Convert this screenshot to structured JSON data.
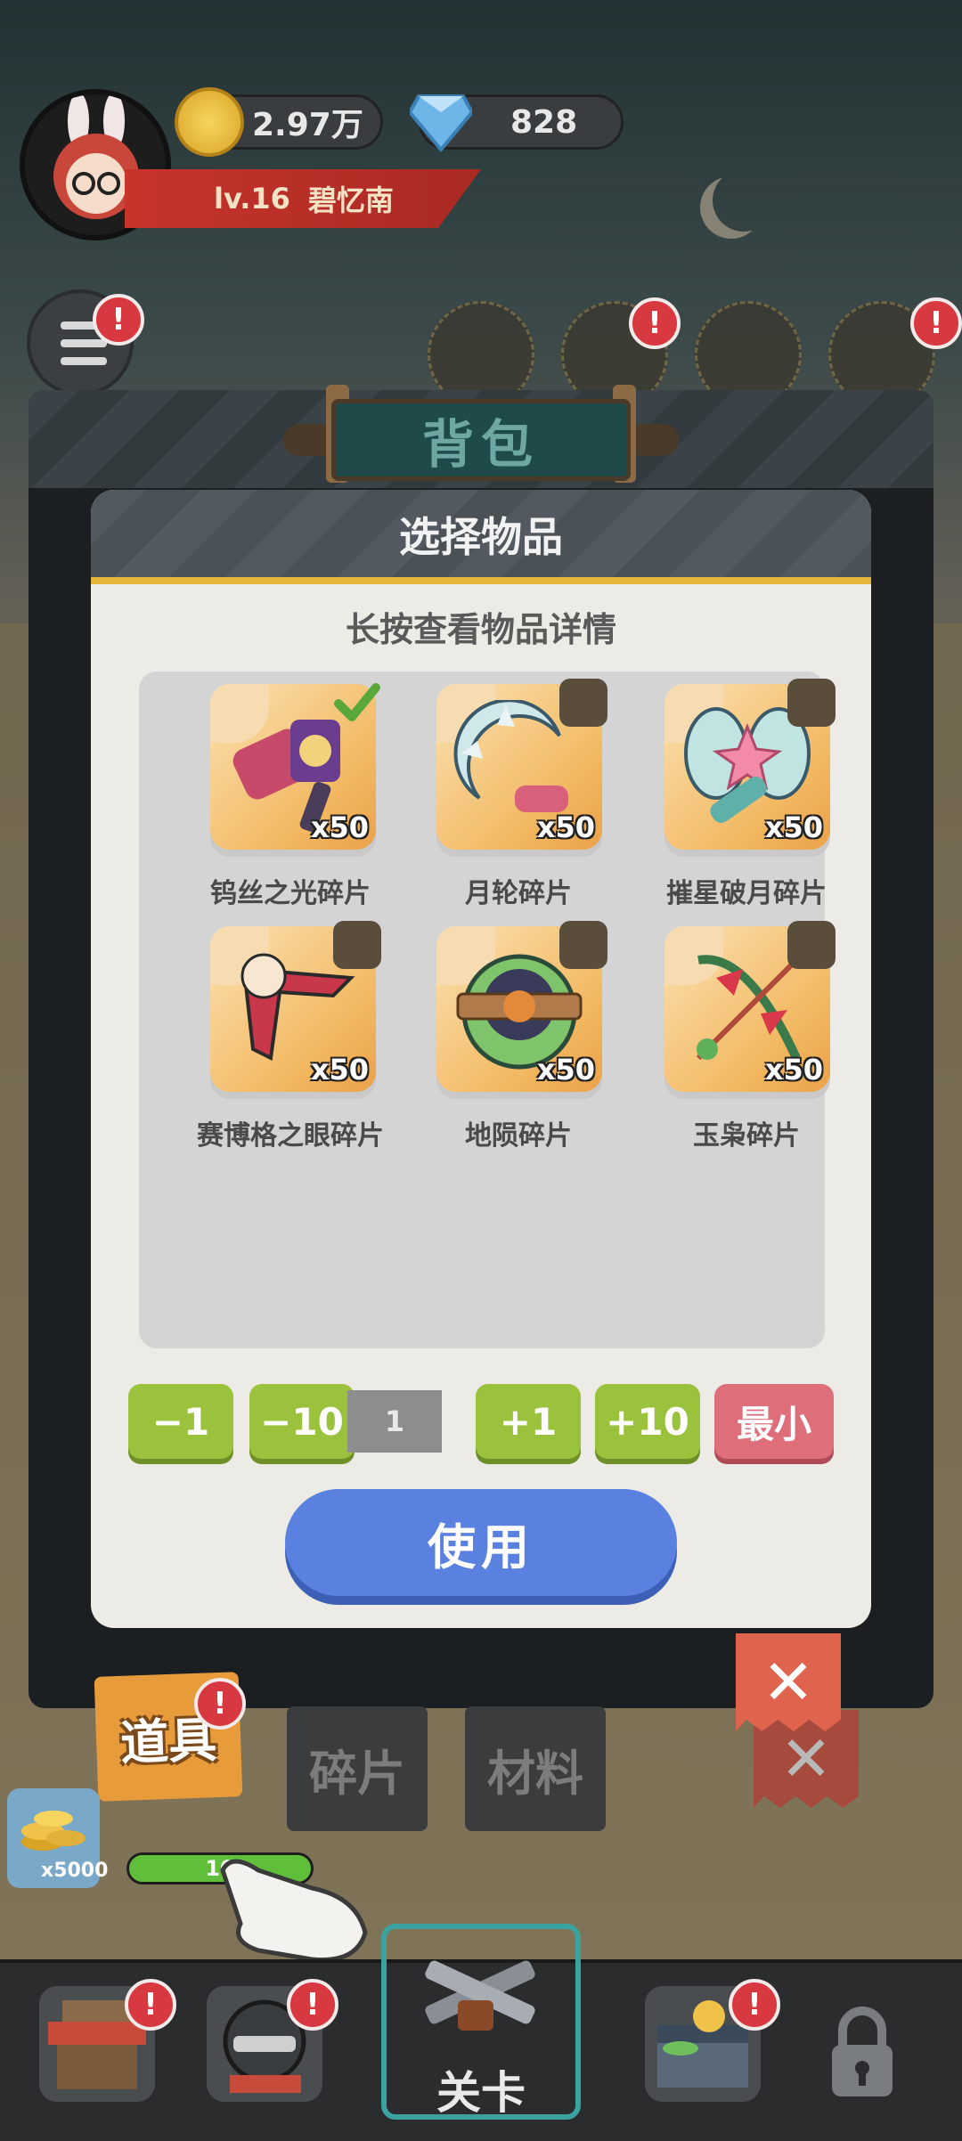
{
  "hud": {
    "coins": "2.97万",
    "gems": "828",
    "level": "lv.16",
    "player_name": "碧忆南"
  },
  "panel": {
    "title": "背包"
  },
  "dialog": {
    "title": "选择物品",
    "hint": "长按查看物品详情",
    "items": [
      {
        "name": "钨丝之光碎片",
        "qty": "x50",
        "selected": true,
        "icon": "hammer-lantern-icon"
      },
      {
        "name": "月轮碎片",
        "qty": "x50",
        "selected": false,
        "icon": "spiked-moon-icon"
      },
      {
        "name": "摧星破月碎片",
        "qty": "x50",
        "selected": false,
        "icon": "star-axe-icon"
      },
      {
        "name": "赛博格之眼碎片",
        "qty": "x50",
        "selected": false,
        "icon": "boomerang-eye-icon"
      },
      {
        "name": "地陨碎片",
        "qty": "x50",
        "selected": false,
        "icon": "boom-meteor-icon"
      },
      {
        "name": "玉枭碎片",
        "qty": "x50",
        "selected": false,
        "icon": "jade-bow-icon"
      }
    ],
    "stepper": {
      "minus1": "−1",
      "minus10": "−10",
      "value": "1",
      "plus1": "+1",
      "plus10": "+10",
      "min": "最小"
    },
    "use_button": "使用"
  },
  "tabs": [
    {
      "label": "道具",
      "active": true
    },
    {
      "label": "碎片",
      "active": false
    },
    {
      "label": "材料",
      "active": false
    }
  ],
  "side_item": {
    "count": "x5000",
    "progress_text": "10"
  },
  "badges": {
    "alert": "!"
  },
  "nav": {
    "stage_label": "关卡"
  },
  "colors": {
    "accent_green": "#9bc23c",
    "use_blue": "#5a80e0",
    "min_red": "#dd6e7a",
    "badge_red": "#d8383f",
    "tab_orange": "#e89b3a"
  }
}
